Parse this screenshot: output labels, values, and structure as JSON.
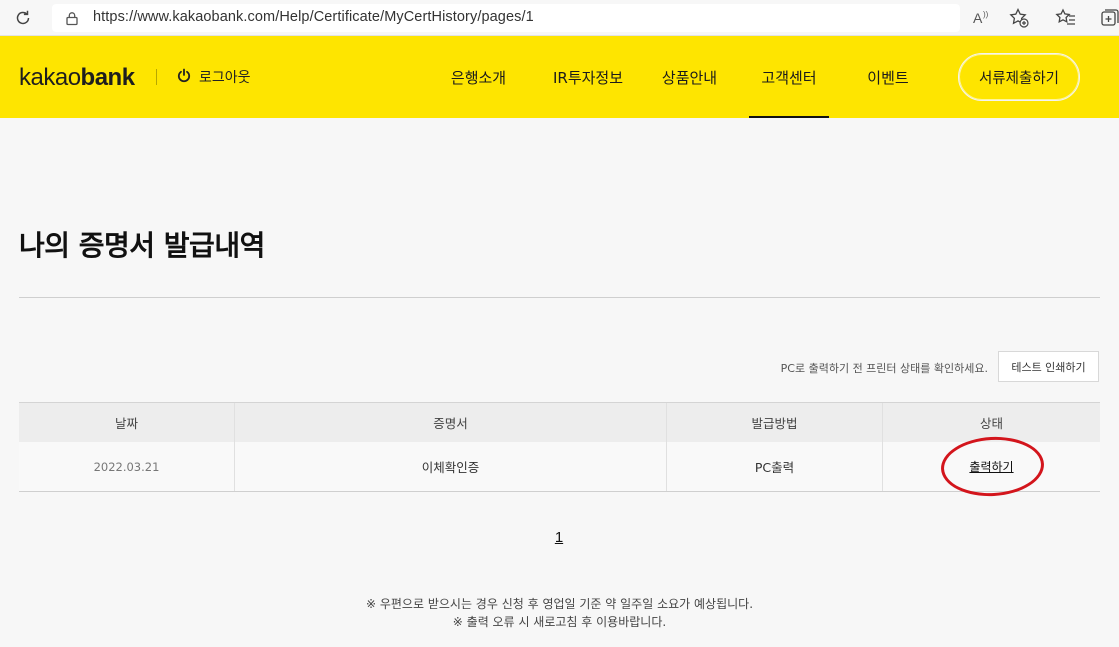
{
  "browser": {
    "url": "https://www.kakaobank.com/Help/Certificate/MyCertHistory/pages/1",
    "read_aloud_label": "Ä́"
  },
  "header": {
    "logo_light": "kakao",
    "logo_bold": "bank",
    "logout_label": "로그아웃",
    "nav": [
      {
        "label": "은행소개"
      },
      {
        "label": "IR투자정보"
      },
      {
        "label": "상품안내"
      },
      {
        "label": "고객센터"
      },
      {
        "label": "이벤트"
      }
    ],
    "active_nav": "고객센터",
    "submit_button": "서류제출하기",
    "brand_color": "#fee500"
  },
  "main": {
    "title": "나의 증명서 발급내역",
    "printer_notice": "PC로 출력하기 전 프린터 상태를 확인하세요.",
    "test_print_button": "테스트 인쇄하기",
    "table": {
      "headers": [
        "날짜",
        "증명서",
        "발급방법",
        "상태"
      ],
      "rows": [
        {
          "date": "2022.03.21",
          "certificate": "이체확인증",
          "method": "PC출력",
          "status": "출력하기"
        }
      ]
    },
    "pagination": {
      "current": "1"
    },
    "footnotes": [
      "※ 우편으로 받으시는 경우 신청 후 영업일 기준 약 일주일 소요가 예상됩니다.",
      "※ 출력 오류 시 새로고침 후 이용바랍니다."
    ],
    "highlight_color": "#d3151c"
  }
}
